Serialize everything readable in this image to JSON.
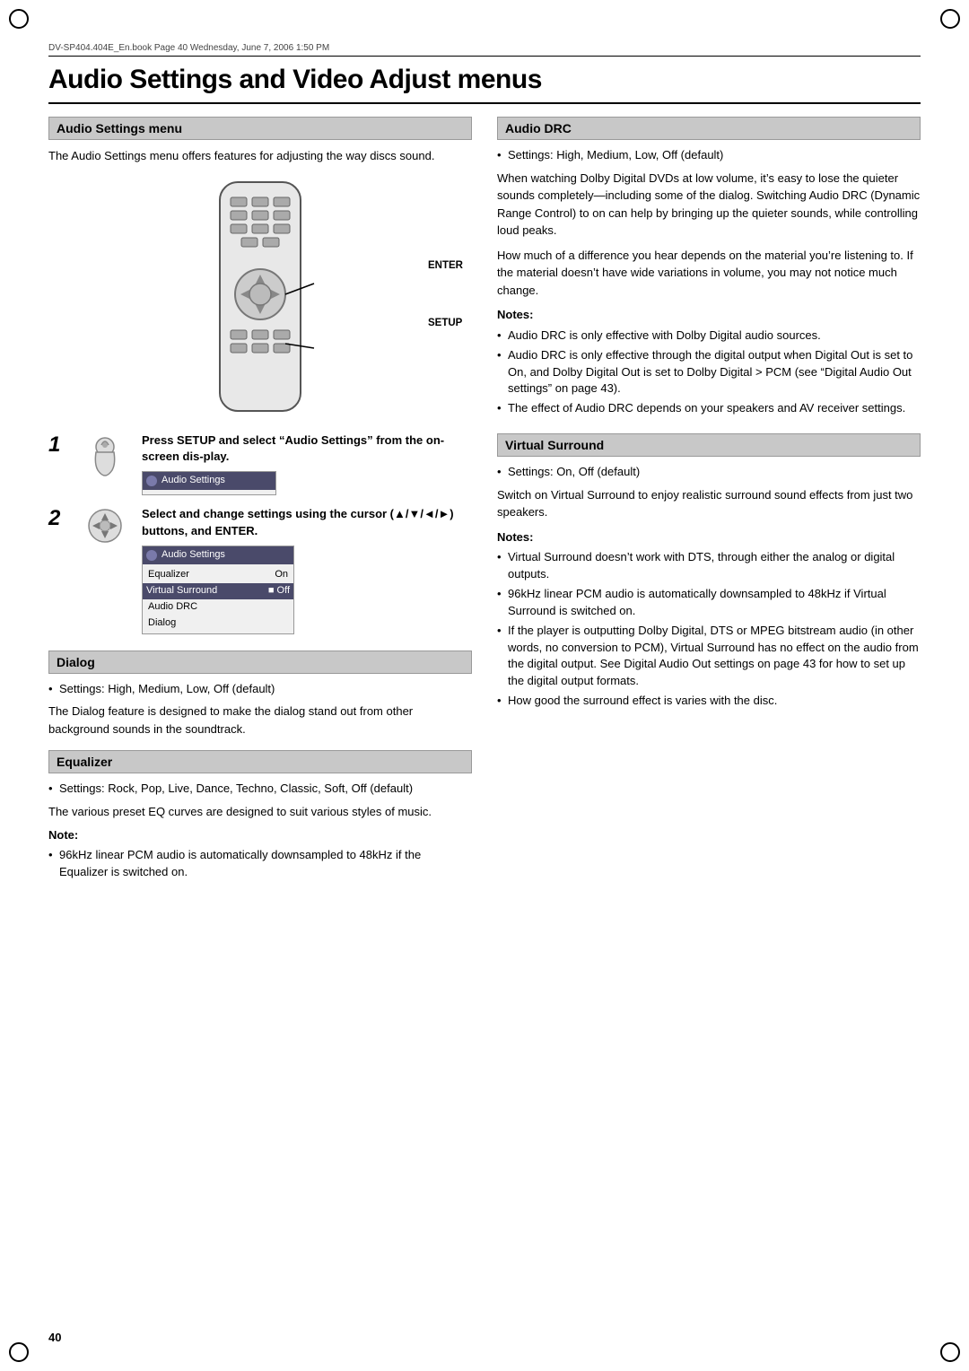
{
  "meta": {
    "header_text": "DV-SP404.404E_En.book  Page 40  Wednesday, June 7, 2006  1:50 PM"
  },
  "page": {
    "number": "40",
    "title": "Audio Settings and Video Adjust menus"
  },
  "sections": {
    "audio_settings_menu": {
      "header": "Audio Settings menu",
      "intro": "The Audio Settings menu offers features for adjusting the way discs sound.",
      "step1": {
        "number": "1",
        "bold_text": "Press SETUP and select “Audio Settings” from the on-screen dis-play.",
        "screen_title": "Audio Settings"
      },
      "step2": {
        "number": "2",
        "bold_text": "Select and change settings using the cursor (▲/▼/◄/►) buttons, and ENTER.",
        "screen_title": "Audio Settings",
        "screen_rows": [
          {
            "label": "Equalizer",
            "value": "On"
          },
          {
            "label": "Virtual Surround",
            "value": "■ Off",
            "highlighted": true
          },
          {
            "label": "Audio DRC",
            "value": ""
          },
          {
            "label": "Dialog",
            "value": ""
          }
        ]
      },
      "remote_label_enter": "ENTER",
      "remote_label_setup": "SETUP"
    },
    "dialog": {
      "header": "Dialog",
      "bullet": "Settings: High, Medium, Low, Off (default)",
      "body": "The Dialog feature is designed to make the dialog stand out from other background sounds in the soundtrack."
    },
    "equalizer": {
      "header": "Equalizer",
      "bullet": "Settings: Rock, Pop, Live, Dance, Techno, Classic, Soft, Off (default)",
      "body": "The various preset EQ curves are designed to suit various styles of music.",
      "note_label": "Note:",
      "note": "96kHz linear PCM audio is automatically downsampled to 48kHz if the Equalizer is switched on."
    },
    "audio_drc": {
      "header": "Audio DRC",
      "bullet": "Settings: High, Medium, Low, Off (default)",
      "body1": "When watching Dolby Digital DVDs at low volume, it’s easy to lose the quieter sounds completely—including some of the dialog. Switching Audio DRC (Dynamic Range Control) to on can help by bringing up the quieter sounds, while controlling loud peaks.",
      "body2": "How much of a difference you hear depends on the material you’re listening to. If the material doesn’t have wide variations in volume, you may not notice much change.",
      "notes_label": "Notes:",
      "notes": [
        "Audio DRC is only effective with Dolby Digital audio sources.",
        "Audio DRC is only effective through the digital output when Digital Out is set to On, and Dolby Digital Out is set to Dolby Digital > PCM (see “Digital Audio Out settings” on page 43).",
        "The effect of Audio DRC depends on your speakers and AV receiver settings."
      ]
    },
    "virtual_surround": {
      "header": "Virtual Surround",
      "bullet": "Settings: On, Off (default)",
      "body": "Switch on Virtual Surround to enjoy realistic surround sound effects from just two speakers.",
      "notes_label": "Notes:",
      "notes": [
        "Virtual Surround doesn’t work with DTS, through either the analog or digital outputs.",
        "96kHz linear PCM audio is automatically downsampled to 48kHz if Virtual Surround is switched on.",
        "If the player is outputting Dolby Digital, DTS or MPEG bitstream audio (in other words, no conversion to PCM), Virtual Surround has no effect on the audio from the digital output. See Digital Audio Out settings on page 43 for how to set up the digital output formats.",
        "How good the surround effect is varies with the disc."
      ]
    }
  }
}
